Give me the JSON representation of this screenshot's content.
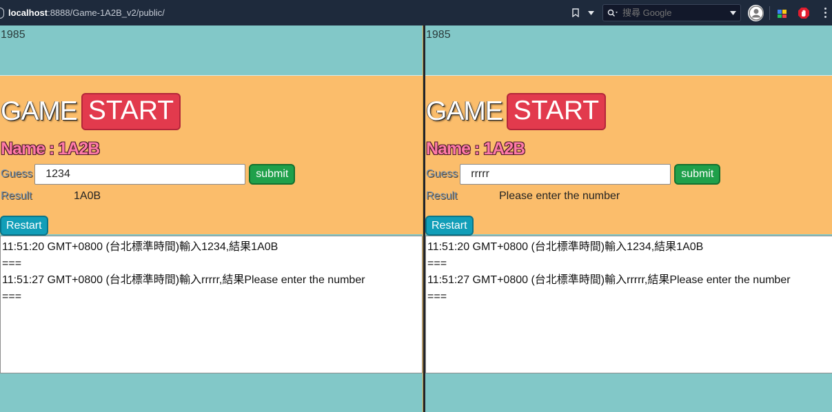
{
  "browser": {
    "url_host": "localhost",
    "url_rest": ":8888/Game-1A2B_v2/public/",
    "search_placeholder": "搜尋 Google"
  },
  "panes": [
    {
      "top_number": "1985",
      "title_game": "GAME",
      "title_start": "START",
      "name_line": "Name : 1A2B",
      "guess_label": "Guess",
      "guess_value": "1234",
      "submit_label": "submit",
      "result_label": "Result",
      "result_value": "1A0B",
      "restart_label": "Restart",
      "log": "11:51:20 GMT+0800 (台北標準時間)輸入1234,結果1A0B\n===\n11:51:27 GMT+0800 (台北標準時間)輸入rrrrr,結果Please enter the number\n==="
    },
    {
      "top_number": "1985",
      "title_game": "GAME",
      "title_start": "START",
      "name_line": "Name : 1A2B",
      "guess_label": "Guess",
      "guess_value": "rrrrr",
      "submit_label": "submit",
      "result_label": "Result",
      "result_value": "Please enter the number",
      "restart_label": "Restart",
      "log": "11:51:20 GMT+0800 (台北標準時間)輸入1234,結果1A0B\n===\n11:51:27 GMT+0800 (台北標準時間)輸入rrrrr,結果Please enter the number\n==="
    }
  ],
  "colors": {
    "page_bg": "#82c8c8",
    "panel_bg": "#fbbd6b",
    "start_badge": "#e23a4d",
    "submit_button": "#1fa04a",
    "restart_button": "#119eb8"
  }
}
